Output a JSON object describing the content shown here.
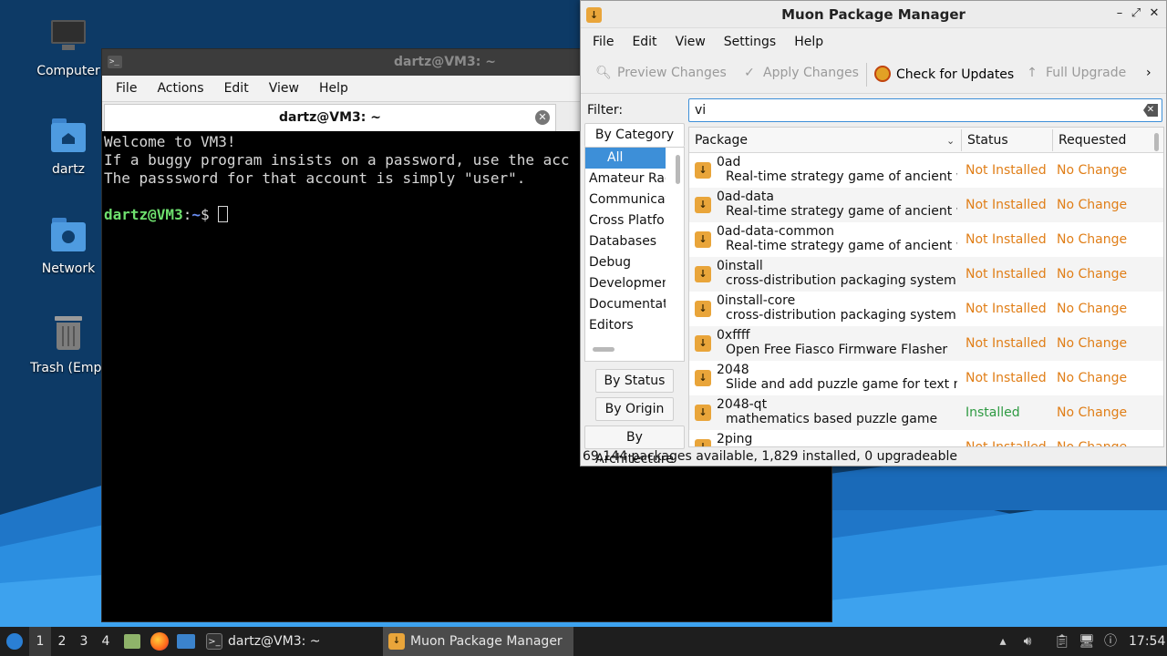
{
  "desktop": {
    "icons": [
      {
        "label": "Computer",
        "icon": "computer-icon"
      },
      {
        "label": "dartz",
        "icon": "home-folder-icon"
      },
      {
        "label": "Network",
        "icon": "network-folder-icon"
      },
      {
        "label": "Trash (Empt",
        "icon": "trash-icon"
      }
    ]
  },
  "terminal": {
    "window_title": "dartz@VM3: ~",
    "menu": [
      "File",
      "Actions",
      "Edit",
      "View",
      "Help"
    ],
    "tab_title": "dartz@VM3: ~",
    "lines": [
      "Welcome to VM3!",
      "If a buggy program insists on a password, use the acc",
      "The passsword for that account is simply \"user\"."
    ],
    "prompt_user": "dartz@VM3",
    "prompt_sep": ":",
    "prompt_path": "~",
    "prompt_char": "$ "
  },
  "muon": {
    "window_title": "Muon Package Manager",
    "menu": [
      "File",
      "Edit",
      "View",
      "Settings",
      "Help"
    ],
    "toolbar": {
      "preview": "Preview Changes",
      "apply": "Apply Changes",
      "check": "Check for Updates",
      "upgrade": "Full Upgrade"
    },
    "filter": {
      "label": "Filter:",
      "value": "vi"
    },
    "groups": {
      "category": "By Category",
      "status": "By Status",
      "origin": "By Origin",
      "architecture": "By Architecture"
    },
    "categories": [
      "All",
      "Amateur Rad",
      "Communicat",
      "Cross Platfo",
      "Databases",
      "Debug",
      "Developmen",
      "Documentat",
      "Editors"
    ],
    "columns": {
      "package": "Package",
      "status": "Status",
      "requested": "Requested"
    },
    "packages": [
      {
        "name": "0ad",
        "desc": "Real-time strategy game of ancient warfare",
        "status": "Not Installed",
        "requested": "No Change"
      },
      {
        "name": "0ad-data",
        "desc": "Real-time strategy game of ancient warfare",
        "status": "Not Installed",
        "requested": "No Change"
      },
      {
        "name": "0ad-data-common",
        "desc": "Real-time strategy game of ancient warfare",
        "status": "Not Installed",
        "requested": "No Change"
      },
      {
        "name": "0install",
        "desc": "cross-distribution packaging system",
        "status": "Not Installed",
        "requested": "No Change"
      },
      {
        "name": "0install-core",
        "desc": "cross-distribution packaging system (",
        "status": "Not Installed",
        "requested": "No Change"
      },
      {
        "name": "0xffff",
        "desc": "Open Free Fiasco Firmware Flasher",
        "status": "Not Installed",
        "requested": "No Change"
      },
      {
        "name": "2048",
        "desc": "Slide and add puzzle game for text m",
        "status": "Not Installed",
        "requested": "No Change"
      },
      {
        "name": "2048-qt",
        "desc": "mathematics based puzzle game",
        "status": "Installed",
        "requested": "No Change"
      },
      {
        "name": "2ping",
        "desc": "",
        "status": "Not Installed",
        "requested": "No Change"
      }
    ],
    "statusbar": "69,144 packages available, 1,829 installed, 0 upgradeable",
    "colors": {
      "not_installed": "#e07e17",
      "installed": "#2e9a42",
      "selection": "#3d8fd8"
    }
  },
  "taskbar": {
    "workspaces": [
      "1",
      "2",
      "3",
      "4"
    ],
    "tasks": [
      {
        "label": "dartz@VM3: ~",
        "icon": "terminal-icon"
      },
      {
        "label": "Muon Package Manager",
        "icon": "muon-icon"
      }
    ],
    "clock": "17:54"
  }
}
